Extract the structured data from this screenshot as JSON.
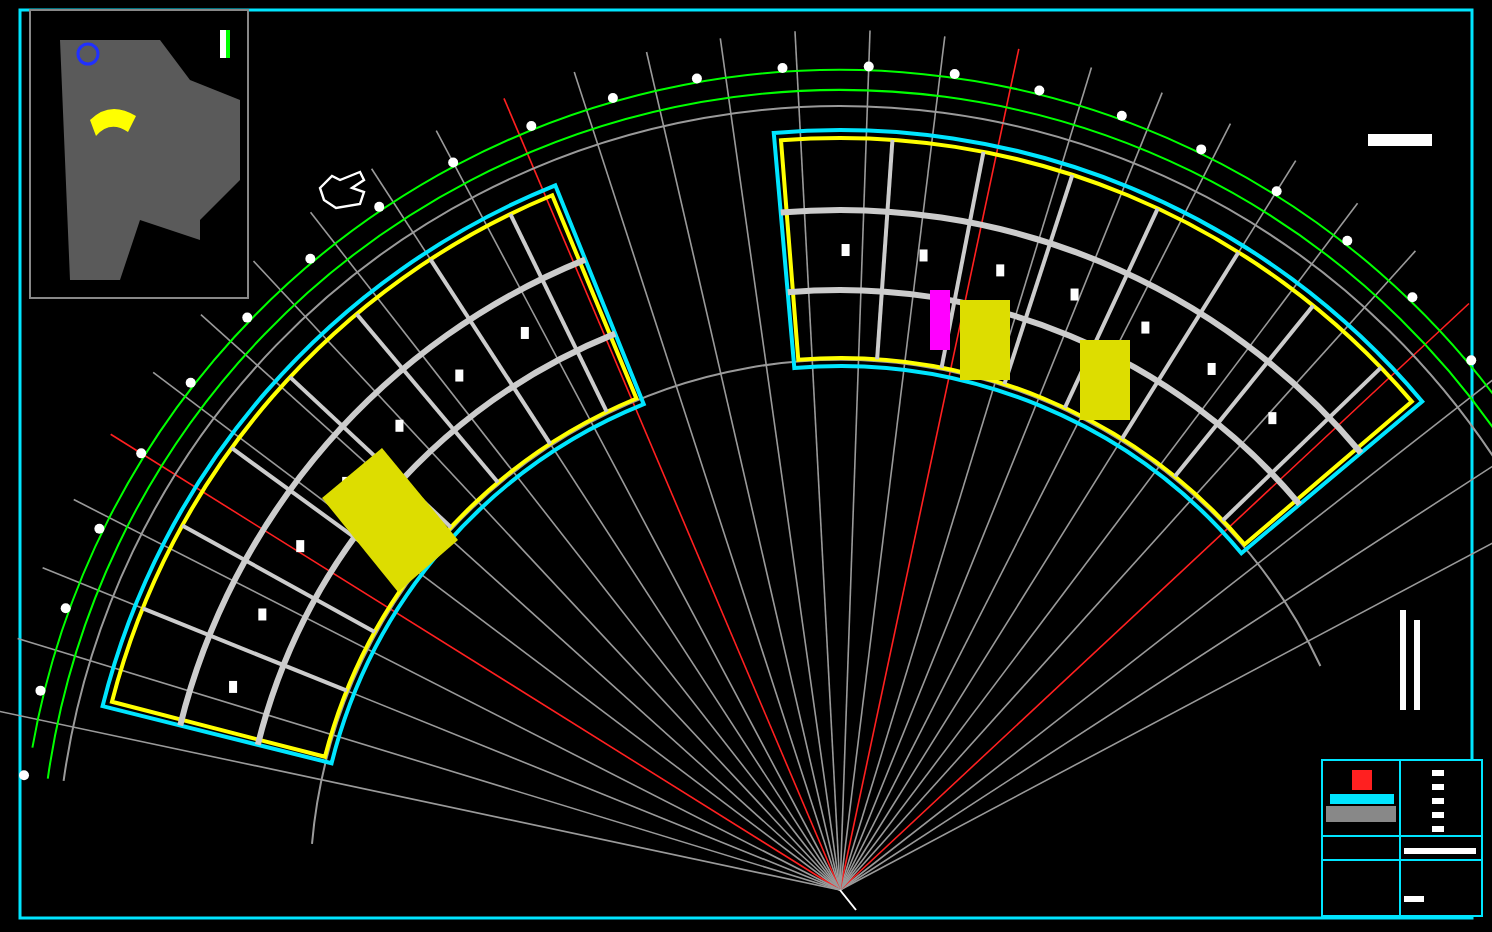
{
  "drawing": {
    "kind": "arc-floor-plan"
  }
}
